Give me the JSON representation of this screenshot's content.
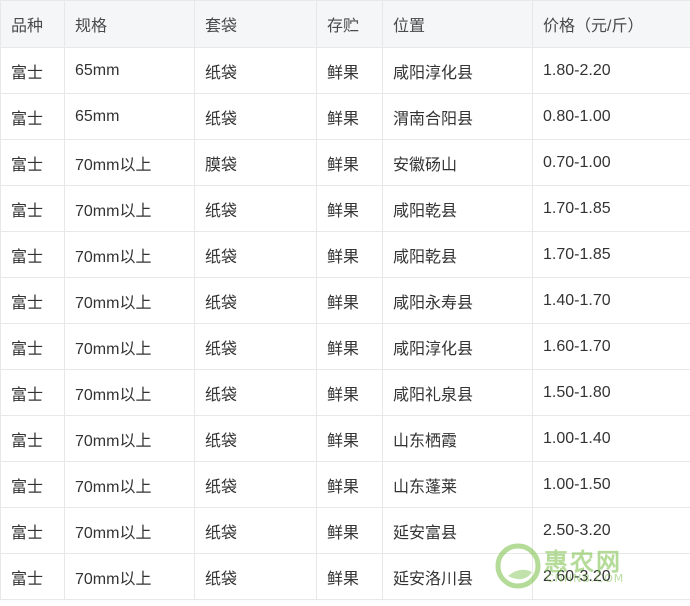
{
  "table": {
    "headers": [
      "品种",
      "规格",
      "套袋",
      "存贮",
      "位置",
      "价格（元/斤）"
    ],
    "rows": [
      [
        "富士",
        "65mm",
        "纸袋",
        "鲜果",
        "咸阳淳化县",
        "1.80-2.20"
      ],
      [
        "富士",
        "65mm",
        "纸袋",
        "鲜果",
        "渭南合阳县",
        "0.80-1.00"
      ],
      [
        "富士",
        "70mm以上",
        "膜袋",
        "鲜果",
        "安徽砀山",
        "0.70-1.00"
      ],
      [
        "富士",
        "70mm以上",
        "纸袋",
        "鲜果",
        "咸阳乾县",
        "1.70-1.85"
      ],
      [
        "富士",
        "70mm以上",
        "纸袋",
        "鲜果",
        "咸阳乾县",
        "1.70-1.85"
      ],
      [
        "富士",
        "70mm以上",
        "纸袋",
        "鲜果",
        "咸阳永寿县",
        "1.40-1.70"
      ],
      [
        "富士",
        "70mm以上",
        "纸袋",
        "鲜果",
        "咸阳淳化县",
        "1.60-1.70"
      ],
      [
        "富士",
        "70mm以上",
        "纸袋",
        "鲜果",
        "咸阳礼泉县",
        "1.50-1.80"
      ],
      [
        "富士",
        "70mm以上",
        "纸袋",
        "鲜果",
        "山东栖霞",
        "1.00-1.40"
      ],
      [
        "富士",
        "70mm以上",
        "纸袋",
        "鲜果",
        "山东蓬莱",
        "1.00-1.50"
      ],
      [
        "富士",
        "70mm以上",
        "纸袋",
        "鲜果",
        "延安富县",
        "2.50-3.20"
      ],
      [
        "富士",
        "70mm以上",
        "纸袋",
        "鲜果",
        "延安洛川县",
        "2.60-3.20"
      ]
    ]
  },
  "watermark": {
    "name": "惠农网",
    "site": "CNHNB.COM",
    "color": "#78be46"
  }
}
